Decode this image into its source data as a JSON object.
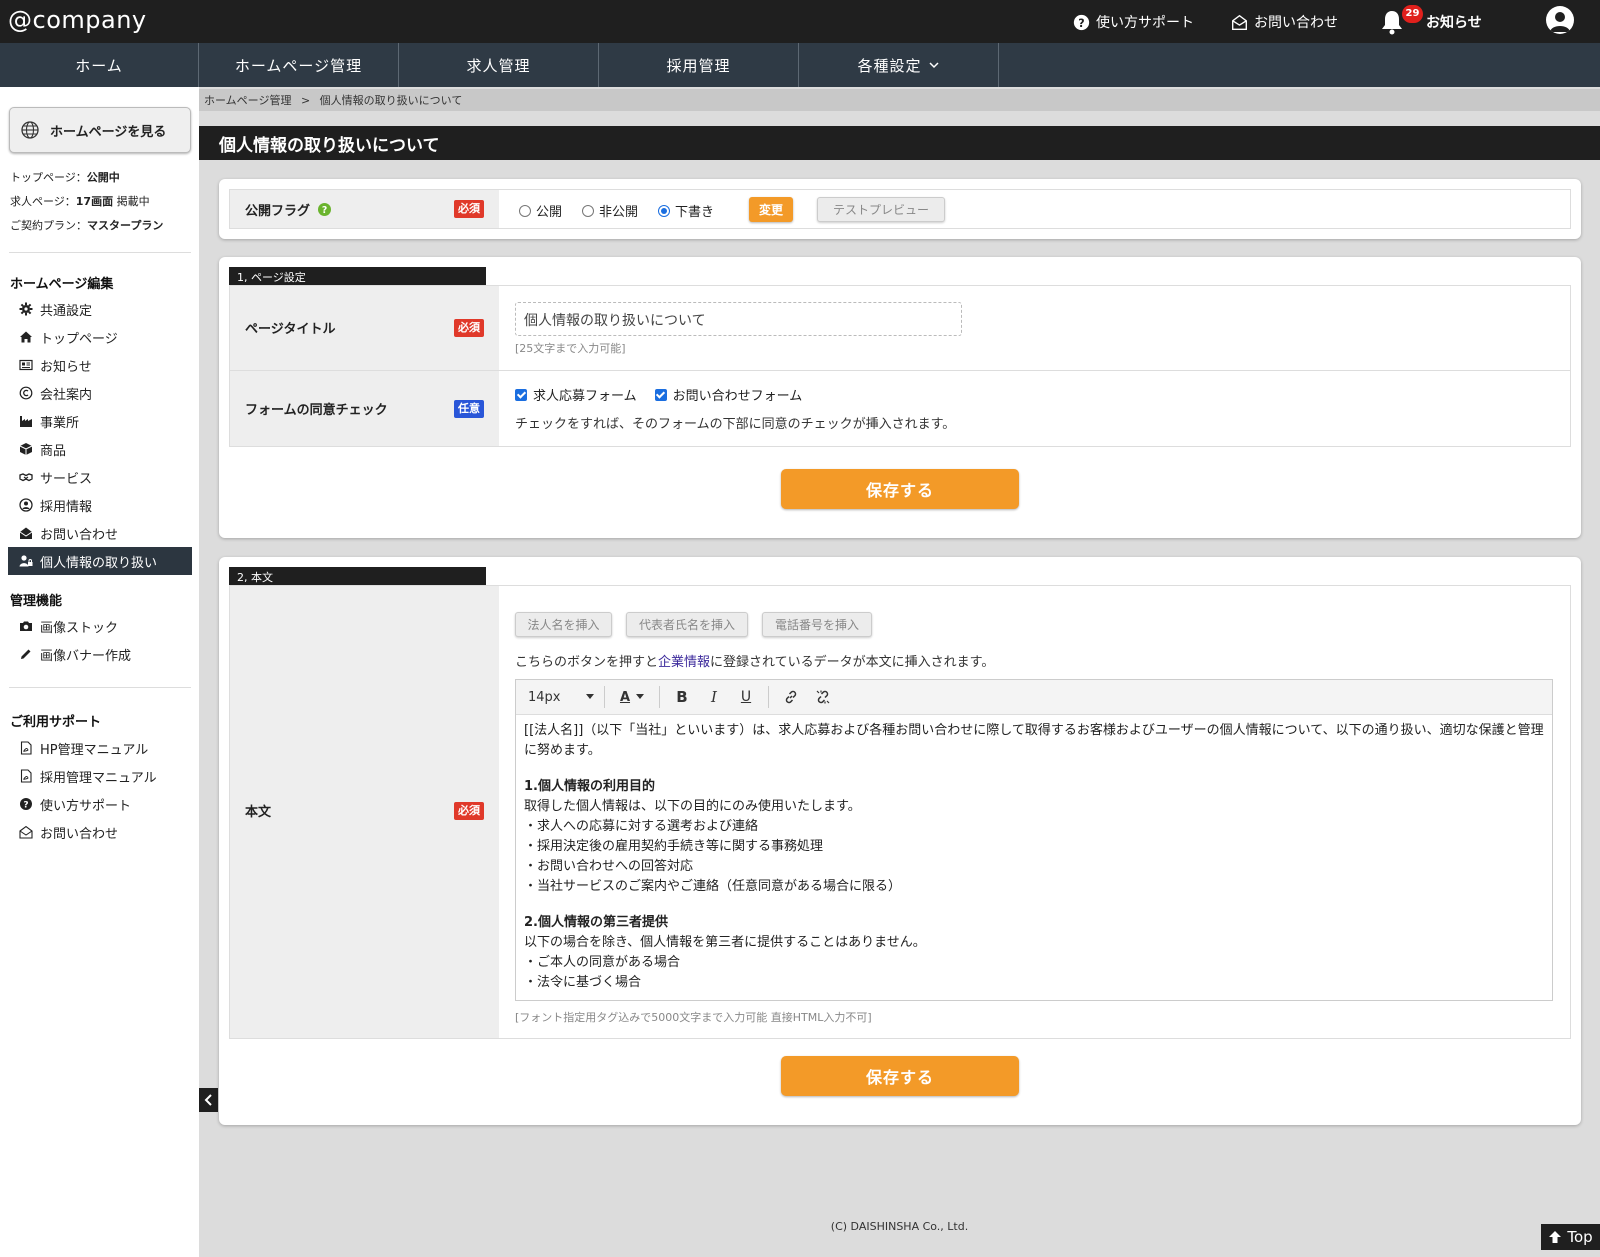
{
  "header": {
    "logo": "@company",
    "support": "使い方サポート",
    "contact": "お問い合わせ",
    "notice_count": "29",
    "notice": "お知らせ"
  },
  "nav": {
    "home": "ホーム",
    "homepage": "ホームページ管理",
    "jobs": "求人管理",
    "recruit": "採用管理",
    "settings": "各種設定"
  },
  "sidebar": {
    "view_site": "ホームページを見る",
    "top_label": "トップページ：",
    "top_value": "公開中",
    "job_label": "求人ページ：",
    "job_value": "17画面",
    "job_suffix": " 掲載中",
    "plan_label": "ご契約プラン：",
    "plan_value": "マスタープラン",
    "edit_heading": "ホームページ編集",
    "edit_items": [
      "共通設定",
      "トップページ",
      "お知らせ",
      "会社案内",
      "事業所",
      "商品",
      "サービス",
      "採用情報",
      "お問い合わせ",
      "個人情報の取り扱い"
    ],
    "manage_heading": "管理機能",
    "manage_items": [
      "画像ストック",
      "画像バナー作成"
    ],
    "support_heading": "ご利用サポート",
    "support_items": [
      "HP管理マニュアル",
      "採用管理マニュアル",
      "使い方サポート",
      "お問い合わせ"
    ]
  },
  "breadcrumb": {
    "parent": "ホームページ管理",
    "sep": ">",
    "current": "個人情報の取り扱いについて"
  },
  "page_title": "個人情報の取り扱いについて",
  "publish": {
    "label": "公開フラグ",
    "required": "必須",
    "options": [
      "公開",
      "非公開",
      "下書き"
    ],
    "selected": "下書き",
    "change_btn": "変更",
    "preview_btn": "テストプレビュー"
  },
  "section1": {
    "tab": "1, ページ設定",
    "title_label": "ページタイトル",
    "title_required": "必須",
    "title_value": "個人情報の取り扱いについて",
    "title_hint": "[25文字まで入力可能]",
    "consent_label": "フォームの同意チェック",
    "consent_optional": "任意",
    "consent_options": [
      "求人応募フォーム",
      "お問い合わせフォーム"
    ],
    "consent_note": "チェックをすれば、そのフォームの下部に同意のチェックが挿入されます。",
    "save_btn": "保存する"
  },
  "section2": {
    "tab": "2, 本文",
    "body_label": "本文",
    "body_required": "必須",
    "insert_btns": [
      "法人名を挿入",
      "代表者氏名を挿入",
      "電話番号を挿入"
    ],
    "note_pre": "こちらのボタンを押すと",
    "note_link": "企業情報",
    "note_post": "に登録されているデータが本文に挿入されます。",
    "font_size": "14px",
    "toolbar": {
      "font_color": "A",
      "bold": "B",
      "italic": "I",
      "underline": "U"
    },
    "content": {
      "intro": "[[法人名]]（以下「当社」といいます）は、求人応募および各種お問い合わせに際して取得するお客様およびユーザーの個人情報について、以下の通り扱い、適切な保護と管理に努めます。",
      "h1": "1.個人情報の利用目的",
      "p1": "取得した個人情報は、以下の目的にのみ使用いたします。",
      "l1": [
        "・求人への応募に対する選考および連絡",
        "・採用決定後の雇用契約手続き等に関する事務処理",
        "・お問い合わせへの回答対応",
        "・当社サービスのご案内やご連絡（任意同意がある場合に限る）"
      ],
      "h2": "2.個人情報の第三者提供",
      "p2": "以下の場合を除き、個人情報を第三者に提供することはありません。",
      "l2": [
        "・ご本人の同意がある場合",
        "・法令に基づく場合"
      ]
    },
    "hint": "[フォント指定用タグ込みで5000文字まで入力可能 直接HTML入力不可]",
    "save_btn": "保存する"
  },
  "footer": "(C) DAISHINSHA Co., Ltd.",
  "top_btn": "Top"
}
